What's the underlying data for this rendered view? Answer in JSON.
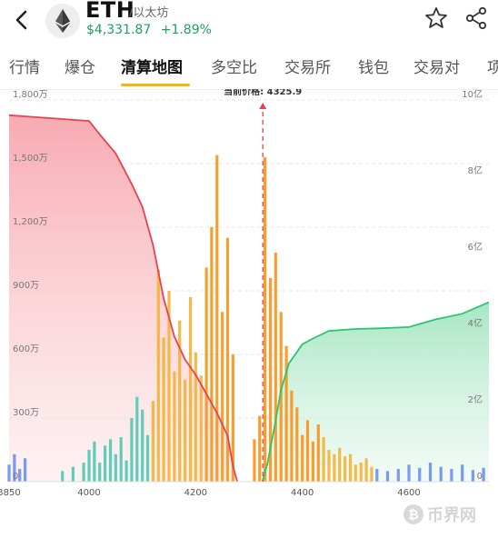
{
  "header": {
    "back_icon": "chevron-left-icon",
    "coin_icon": "ethereum-icon",
    "symbol": "ETH",
    "name": "/以太坊",
    "price": "$4,331.87",
    "change": "+1.89%",
    "change_color": "#1aa35a",
    "star_icon": "star-outline-icon",
    "share_icon": "share-icon"
  },
  "tabs": {
    "items": [
      "行情",
      "爆仓",
      "清算地图",
      "多空比",
      "交易所",
      "钱包",
      "交易对",
      "项"
    ],
    "active_index": 2,
    "accent": "#f0b90b"
  },
  "chart_data": {
    "type": "area",
    "current_price_label": "当前价格: 4325.9",
    "current_price": 4325.9,
    "x_ticks": [
      "3850",
      "4000",
      "4200",
      "4400",
      "4600"
    ],
    "xlim": [
      3850,
      4750
    ],
    "y_left_ticks": [
      "0",
      "300万",
      "600万",
      "900万",
      "1,200万",
      "1,500万",
      "1,800万"
    ],
    "ylim_left": [
      0,
      18000000
    ],
    "y_right_ticks": [
      "0",
      "2亿",
      "4亿",
      "6亿",
      "8亿",
      "10亿"
    ],
    "ylim_right": [
      0,
      1000000000
    ],
    "grid": true,
    "colors": {
      "short_line": "#e8414f",
      "long_line": "#28c76f",
      "bars_near": "#f7931a",
      "bars_mid": "#f3b234",
      "bars_far": "#4fc9b4",
      "bars_edge": "#6c8ff0",
      "price_line": "#e8414f"
    },
    "series": [
      {
        "points": [
          [
            3850,
            960000000
          ],
          [
            3900,
            955000000
          ],
          [
            3950,
            950000000
          ],
          [
            4000,
            945000000
          ],
          [
            4020,
            910000000
          ],
          [
            4050,
            860000000
          ],
          [
            4080,
            780000000
          ],
          [
            4100,
            720000000
          ],
          [
            4120,
            620000000
          ],
          [
            4140,
            480000000
          ],
          [
            4160,
            380000000
          ],
          [
            4180,
            320000000
          ],
          [
            4200,
            280000000
          ],
          [
            4220,
            230000000
          ],
          [
            4240,
            180000000
          ],
          [
            4260,
            120000000
          ],
          [
            4270,
            40000000
          ],
          [
            4278,
            0
          ]
        ]
      },
      {
        "points": [
          [
            4325,
            0
          ],
          [
            4335,
            50000000
          ],
          [
            4350,
            160000000
          ],
          [
            4360,
            240000000
          ],
          [
            4375,
            310000000
          ],
          [
            4400,
            360000000
          ],
          [
            4420,
            375000000
          ],
          [
            4450,
            395000000
          ],
          [
            4500,
            400000000
          ],
          [
            4550,
            402000000
          ],
          [
            4600,
            405000000
          ],
          [
            4650,
            425000000
          ],
          [
            4700,
            440000000
          ],
          [
            4750,
            470000000
          ]
        ]
      }
    ],
    "bars_2": [
      [
        3850,
        800000
      ],
      [
        3860,
        1300000
      ],
      [
        3870,
        600000
      ],
      [
        3880,
        1100000
      ],
      [
        3950,
        500000
      ],
      [
        3970,
        700000
      ],
      [
        3990,
        900000
      ],
      [
        4000,
        1500000
      ],
      [
        4010,
        1900000
      ],
      [
        4020,
        900000
      ],
      [
        4030,
        1700000
      ],
      [
        4040,
        2000000
      ],
      [
        4050,
        1300000
      ],
      [
        4060,
        2100000
      ],
      [
        4070,
        1000000
      ],
      [
        4080,
        3000000
      ],
      [
        4090,
        4000000
      ],
      [
        4100,
        3400000
      ],
      [
        4110,
        2200000
      ],
      [
        4120,
        3800000
      ],
      [
        4130,
        10000000
      ],
      [
        4140,
        6800000
      ],
      [
        4150,
        9000000
      ],
      [
        4160,
        5200000
      ],
      [
        4170,
        7600000
      ],
      [
        4180,
        4800000
      ],
      [
        4190,
        8700000
      ],
      [
        4200,
        6100000
      ],
      [
        4210,
        5000000
      ],
      [
        4220,
        10100000
      ],
      [
        4230,
        12000000
      ],
      [
        4240,
        15400000
      ],
      [
        4250,
        8000000
      ],
      [
        4260,
        11500000
      ],
      [
        4270,
        6000000
      ],
      [
        4310,
        2000000
      ],
      [
        4320,
        3100000
      ],
      [
        4330,
        15300000
      ],
      [
        4340,
        9600000
      ],
      [
        4350,
        10800000
      ],
      [
        4360,
        8000000
      ],
      [
        4370,
        6400000
      ],
      [
        4380,
        4300000
      ],
      [
        4390,
        3500000
      ],
      [
        4400,
        2200000
      ],
      [
        4410,
        2900000
      ],
      [
        4420,
        1900000
      ],
      [
        4430,
        2700000
      ],
      [
        4440,
        2100000
      ],
      [
        4450,
        1500000
      ],
      [
        4460,
        1300000
      ],
      [
        4470,
        1600000
      ],
      [
        4480,
        1200000
      ],
      [
        4490,
        1300000
      ],
      [
        4500,
        800000
      ],
      [
        4510,
        900000
      ],
      [
        4520,
        1100000
      ],
      [
        4530,
        700000
      ],
      [
        4540,
        600000
      ],
      [
        4560,
        500000
      ],
      [
        4580,
        600000
      ],
      [
        4600,
        800000
      ],
      [
        4620,
        650000
      ],
      [
        4640,
        900000
      ],
      [
        4660,
        700000
      ],
      [
        4680,
        600000
      ],
      [
        4700,
        800000
      ],
      [
        4720,
        550000
      ],
      [
        4740,
        650000
      ]
    ]
  },
  "watermark": {
    "text": "币界网",
    "icon": "bitcoin-coin-icon"
  }
}
